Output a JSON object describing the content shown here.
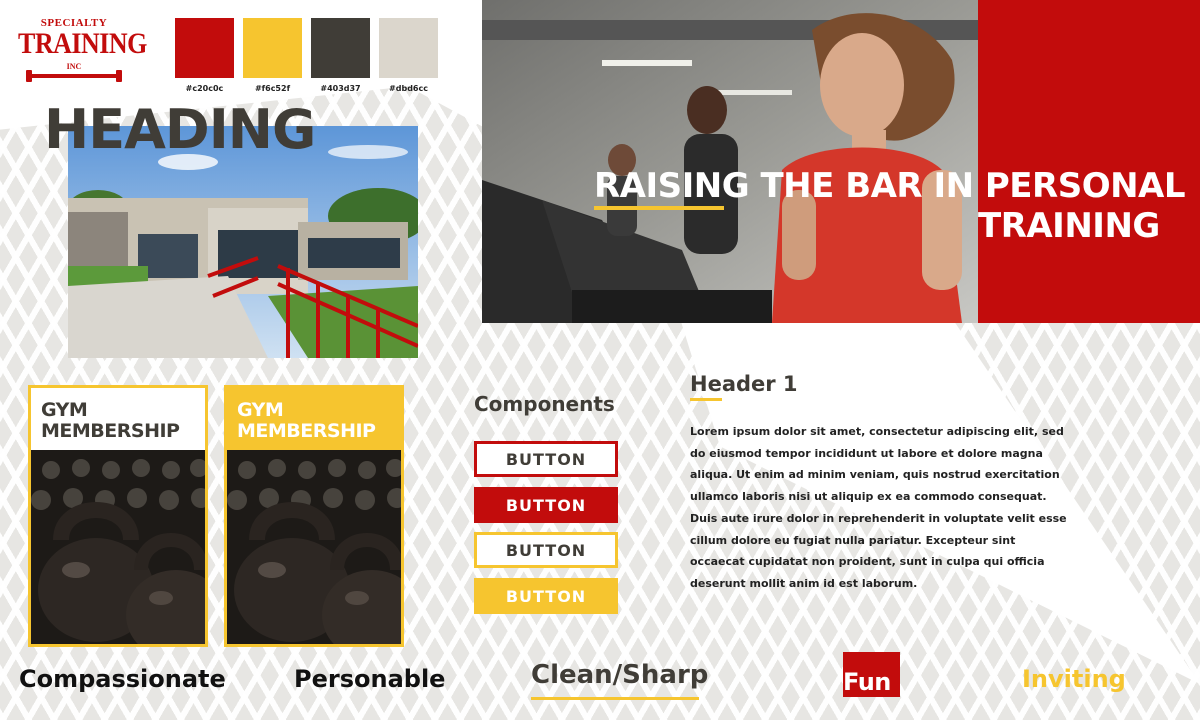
{
  "logo": {
    "top": "SPECIALTY",
    "main": "TRAINING",
    "inc": "INC"
  },
  "palette": [
    {
      "hex": "#c20c0c",
      "label": "#c20c0c"
    },
    {
      "hex": "#f6c52f",
      "label": "#f6c52f"
    },
    {
      "hex": "#403d37",
      "label": "#403d37"
    },
    {
      "hex": "#dbd6cc",
      "label": "#dbd6cc"
    }
  ],
  "heading": "HEADING",
  "hero": {
    "line1": "RAISING THE BAR IN PERSONAL",
    "line2": "TRAINING"
  },
  "cards": [
    {
      "title": "GYM MEMBERSHIP",
      "style": "white"
    },
    {
      "title": "GYM MEMBERSHIP",
      "style": "yellow"
    }
  ],
  "components": {
    "title": "Components",
    "buttons": [
      "BUTTON",
      "BUTTON",
      "BUTTON",
      "BUTTON"
    ]
  },
  "content": {
    "header1": "Header 1",
    "paragraph": "Lorem ipsum dolor sit amet, consectetur adipiscing elit, sed do eiusmod tempor incididunt ut labore et dolore magna aliqua. Ut enim ad minim veniam, quis nostrud exercitation ullamco laboris nisi ut aliquip ex ea commodo consequat. Duis aute irure dolor in reprehenderit in voluptate velit esse cillum dolore eu fugiat nulla pariatur. Excepteur sint occaecat cupidatat non proident, sunt in culpa qui officia deserunt mollit anim id est laborum."
  },
  "keywords": {
    "compassionate": "Compassionate",
    "personable": "Personable",
    "clean": "Clean/Sharp",
    "fun": "Fun",
    "inviting": "Inviting"
  },
  "colors": {
    "red": "#c20c0c",
    "yellow": "#f6c52f",
    "charcoal": "#403d37",
    "stone": "#dbd6cc"
  },
  "images": {
    "building": "gym-building-photo",
    "hero": "treadmill-runners-photo",
    "card": "kettlebells-photo"
  }
}
